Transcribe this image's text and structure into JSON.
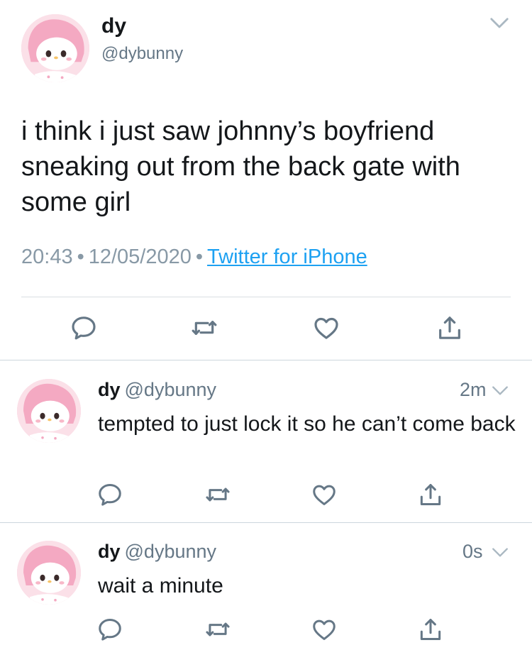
{
  "main_tweet": {
    "display_name": "dy",
    "handle": "@dybunny",
    "text": "i think i just saw johnny’s boyfriend sneaking out from the back gate with some girl",
    "time": "20:43",
    "date": "12/05/2020",
    "separator": "•",
    "source": "Twitter for iPhone"
  },
  "replies": [
    {
      "display_name": "dy",
      "handle": "@dybunny",
      "time": "2m",
      "text": "tempted to just lock it so he can’t come back"
    },
    {
      "display_name": "dy",
      "handle": "@dybunny",
      "time": "0s",
      "text": "wait a minute"
    }
  ],
  "icons": {
    "reply": "reply-icon",
    "retweet": "retweet-icon",
    "like": "heart-icon",
    "share": "share-icon",
    "menu": "chevron-down-icon"
  },
  "colors": {
    "icon_gray": "#657786",
    "link_blue": "#1da1f2",
    "avatar_pink": "#f8cfdc"
  }
}
